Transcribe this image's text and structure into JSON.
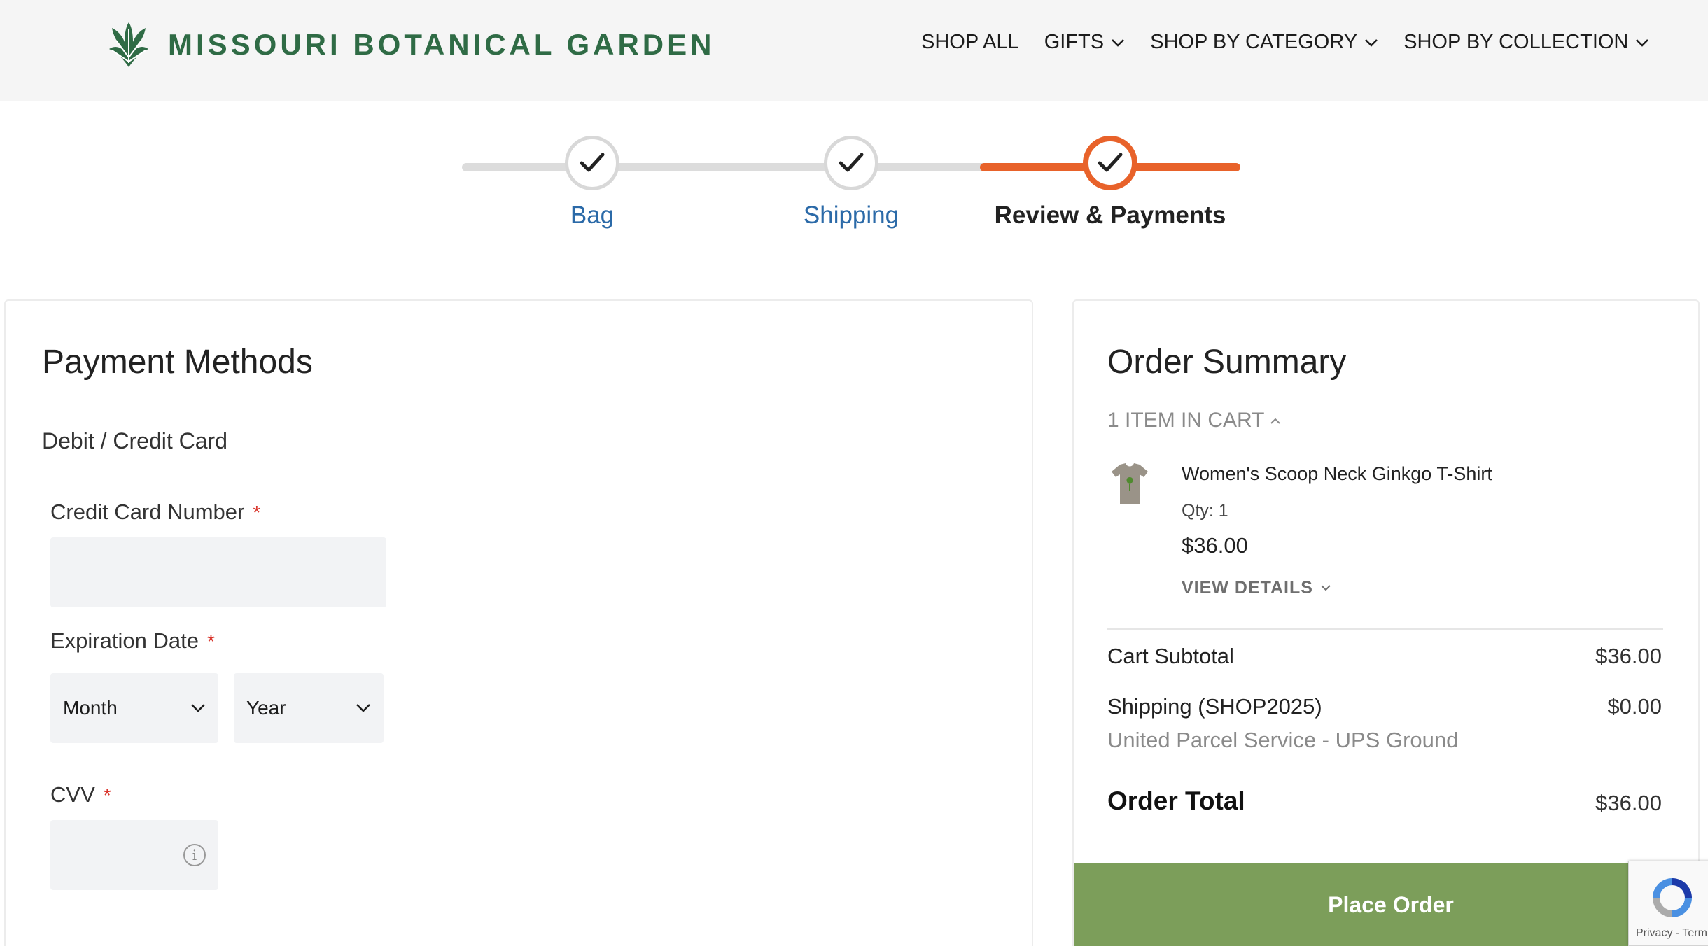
{
  "brand": {
    "name": "MISSOURI BOTANICAL GARDEN",
    "color": "#2f6b45"
  },
  "nav": {
    "items": [
      {
        "label": "SHOP ALL",
        "has_dropdown": false
      },
      {
        "label": "GIFTS",
        "has_dropdown": true
      },
      {
        "label": "SHOP BY CATEGORY",
        "has_dropdown": true
      },
      {
        "label": "SHOP BY COLLECTION",
        "has_dropdown": true
      }
    ]
  },
  "steps": [
    {
      "label": "Bag",
      "state": "done"
    },
    {
      "label": "Shipping",
      "state": "done"
    },
    {
      "label": "Review & Payments",
      "state": "current"
    }
  ],
  "payment": {
    "title": "Payment Methods",
    "method": "Debit / Credit Card",
    "card_number_label": "Credit Card Number",
    "card_number_value": "",
    "expiration_label": "Expiration Date",
    "month_value": "Month",
    "year_value": "Year",
    "cvv_label": "CVV",
    "cvv_value": "",
    "required_mark": "*"
  },
  "summary": {
    "title": "Order Summary",
    "items_toggle": "1 ITEM IN CART",
    "item": {
      "name": "Women's Scoop Neck Ginkgo T-Shirt",
      "qty": "Qty: 1",
      "price": "$36.00",
      "view_details": "VIEW DETAILS",
      "thumbnail_icon": "tshirt-icon"
    },
    "subtotal_label": "Cart Subtotal",
    "subtotal_value": "$36.00",
    "shipping_label": "Shipping (SHOP2025)",
    "shipping_value": "$0.00",
    "shipping_method": "United Parcel Service - UPS Ground",
    "total_label": "Order Total",
    "total_value": "$36.00",
    "place_order_label": "Place Order"
  },
  "recaptcha": {
    "text": "Privacy - Term"
  },
  "colors": {
    "accent": "#e8622a",
    "link": "#2b6aa8",
    "button": "#7c9e5a",
    "header_bg": "#f5f5f5"
  }
}
